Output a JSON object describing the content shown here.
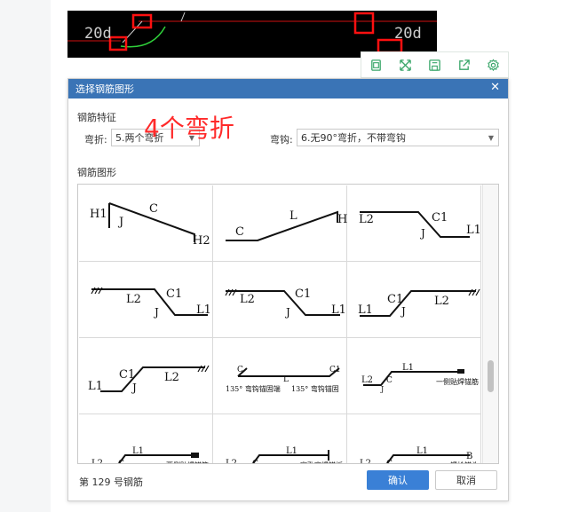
{
  "canvas": {
    "left_label": "20d",
    "right_label": "20d"
  },
  "toolbar": {
    "icons": [
      "copy-icon",
      "expand-icon",
      "save-icon",
      "share-icon",
      "settings-icon"
    ]
  },
  "dialog": {
    "title": "选择钢筋图形",
    "feature_section": "钢筋特征",
    "bend_label": "弯折:",
    "bend_value": "5.两个弯折",
    "hook_label": "弯钩:",
    "hook_value": "6.无90°弯折，不带弯钩",
    "shape_section": "钢筋图形",
    "annotation": "4个弯折",
    "footer_status": "第 129 号钢筋",
    "confirm": "确认",
    "cancel": "取消"
  },
  "shapes": [
    {
      "labels": [
        "H1",
        "C",
        "J",
        "H2"
      ]
    },
    {
      "labels": [
        "C",
        "L",
        "H"
      ]
    },
    {
      "labels": [
        "L2",
        "C1",
        "J",
        "L1"
      ]
    },
    {
      "labels": [
        "L2",
        "C1",
        "J",
        "L1"
      ]
    },
    {
      "labels": [
        "L2",
        "C1",
        "J",
        "L1"
      ]
    },
    {
      "labels": [
        "L1",
        "C1",
        "J",
        "L2"
      ]
    },
    {
      "labels": [
        "L1",
        "C1",
        "J",
        "L2"
      ]
    },
    {
      "labels": [
        "C",
        "L",
        "C1",
        "135° 弯钩锚固端",
        "135° 弯钩锚固"
      ]
    },
    {
      "labels": [
        "L2",
        "C",
        "J",
        "L1",
        "一侧贴焊锚筋"
      ]
    },
    {
      "labels": [
        "L2",
        "C",
        "L1",
        "两侧贴焊锚筋"
      ]
    },
    {
      "labels": [
        "L2",
        "C",
        "L1",
        "穿孔塞焊锚板"
      ]
    },
    {
      "labels": [
        "L2",
        "C",
        "L1",
        "B",
        "螺栓锚头"
      ]
    }
  ],
  "colors": {
    "titlebar": "#3a74b6",
    "confirm": "#3a80d6",
    "annotation": "#ff2a2a",
    "toolbar_icon": "#3aa66a"
  }
}
